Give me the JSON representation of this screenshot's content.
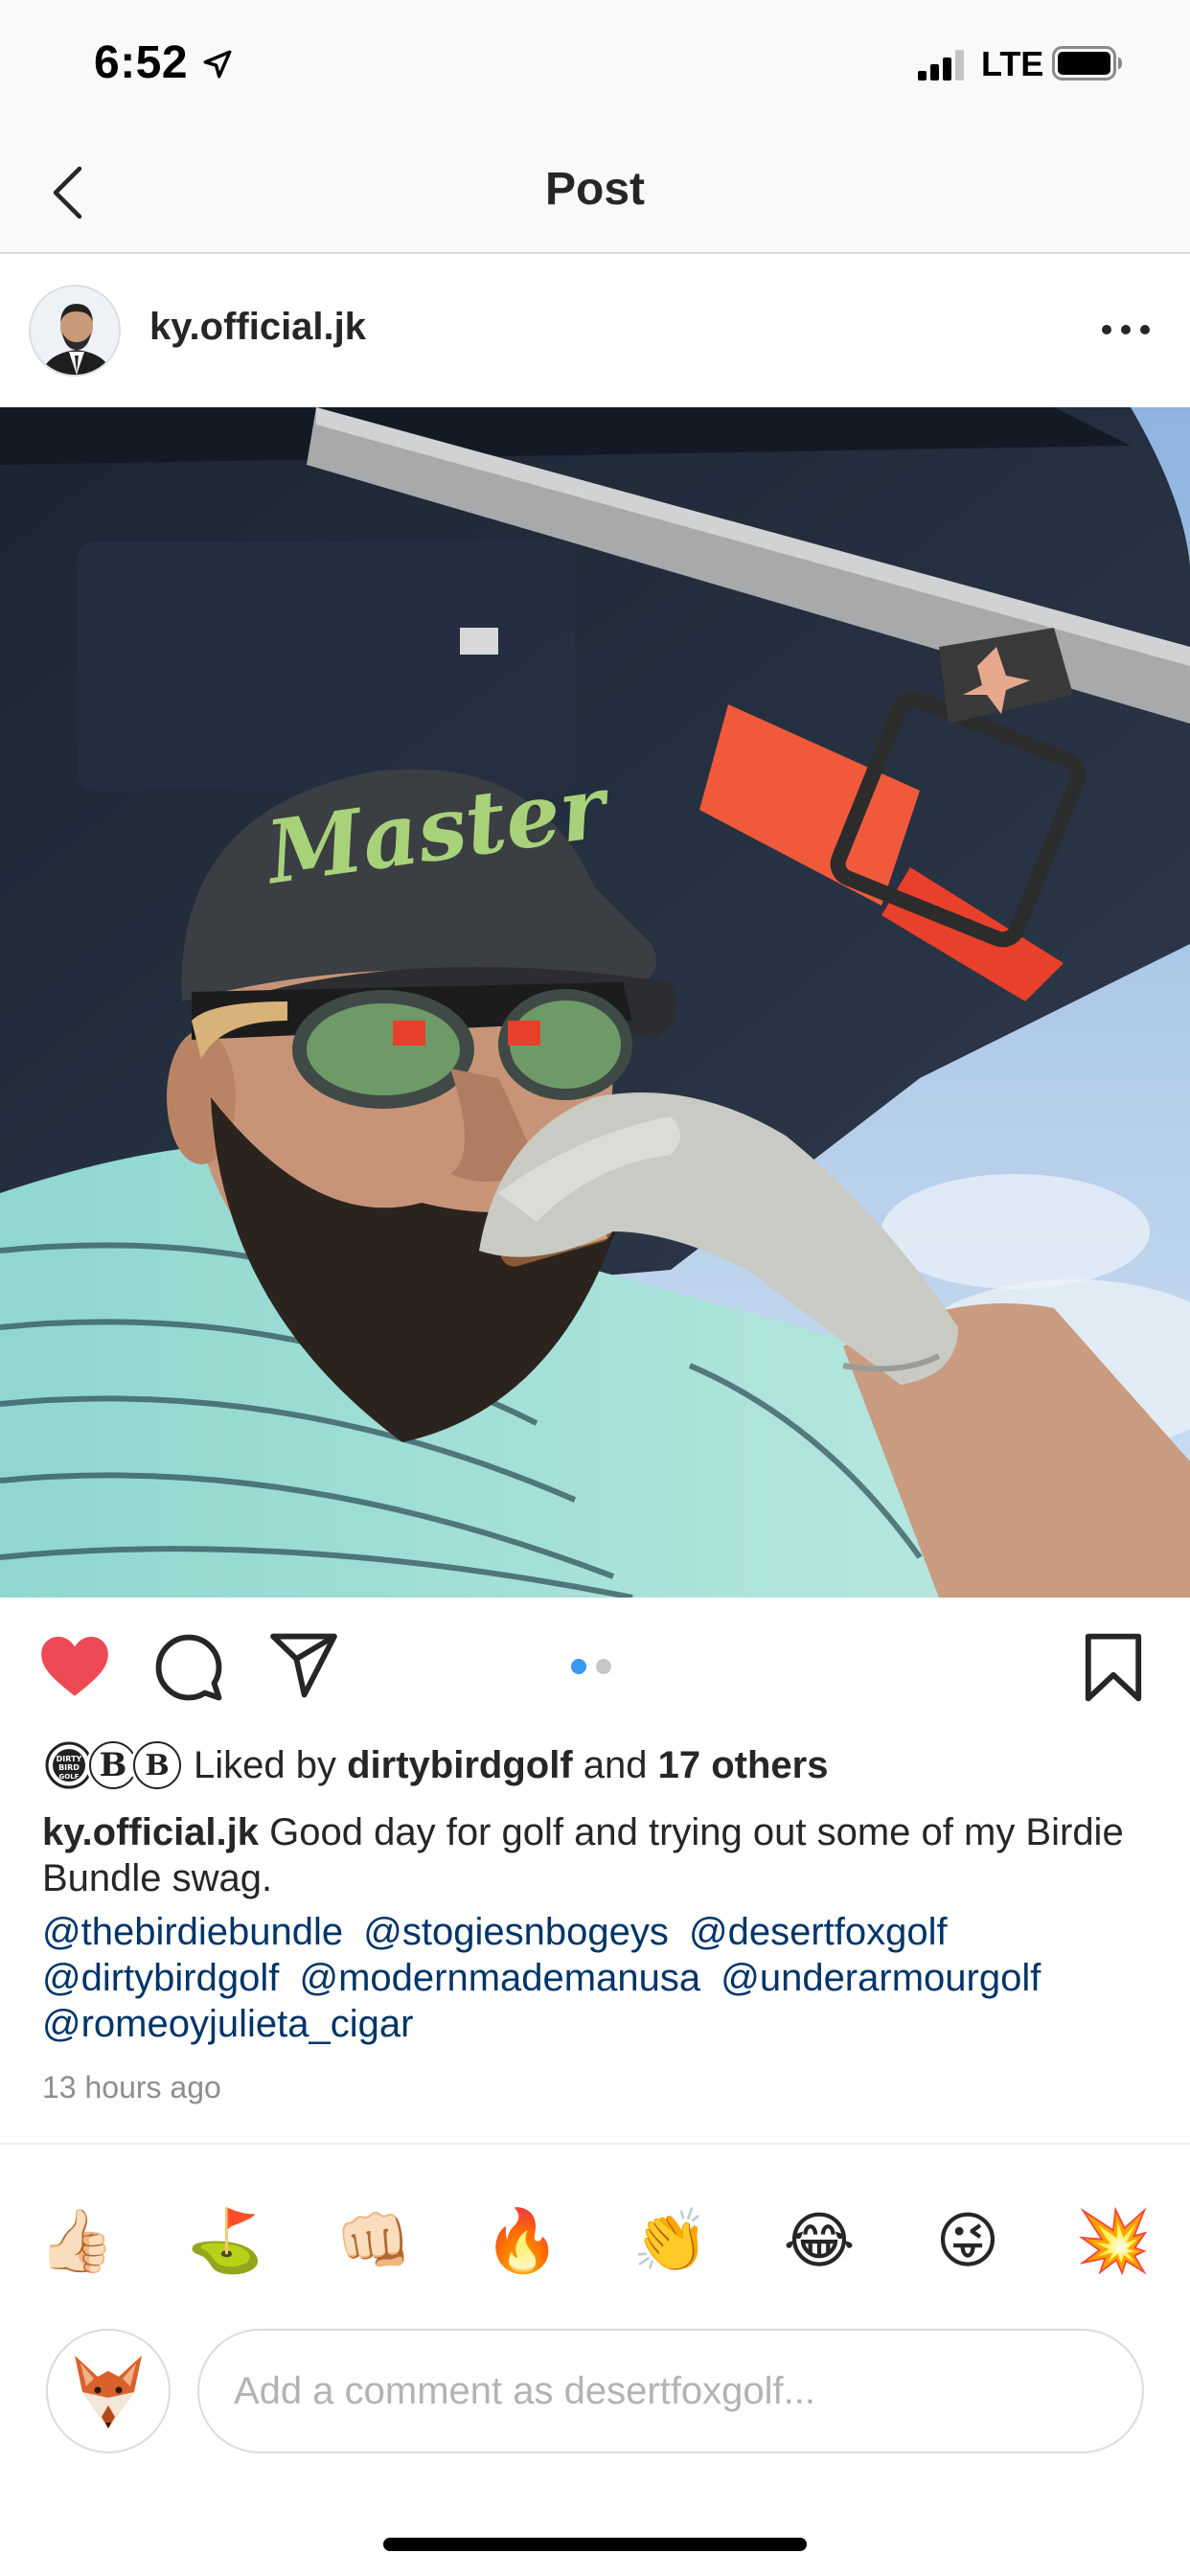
{
  "status_bar": {
    "time": "6:52",
    "network": "LTE"
  },
  "nav": {
    "title": "Post"
  },
  "post": {
    "author": "ky.official.jk",
    "image_slide_count": 2,
    "image_active_slide": 1,
    "liked": true,
    "likes": {
      "prefix": "Liked by ",
      "user": "dirtybirdgolf",
      "middle": " and ",
      "others": "17 others",
      "avatars": [
        "DIRTY BIRD GOLF",
        "B",
        "B"
      ]
    },
    "caption": {
      "user": "ky.official.jk",
      "text": " Good day for golf and trying out some of my Birdie Bundle swag."
    },
    "mentions": [
      "@thebirdiebundle",
      "@stogiesnbogeys",
      "@desertfoxgolf",
      "@dirtybirdgolf",
      "@modernmademanusa",
      "@underarmourgolf",
      "@romeoyjulieta_cigar"
    ],
    "timestamp": "13 hours ago"
  },
  "quick_reactions": [
    "👍🏻",
    "⛳",
    "👊🏻",
    "🔥",
    "👏",
    "😂",
    "😜",
    "💥"
  ],
  "comment": {
    "placeholder": "Add a comment as desertfoxgolf..."
  },
  "colors": {
    "heart": "#ed4956",
    "mention": "#003569",
    "dot_active": "#3897f0",
    "muted": "#8e8e8e"
  },
  "icons": [
    "location-arrow-icon",
    "signal-icon",
    "battery-icon",
    "back-chevron-icon",
    "more-icon",
    "heart-icon",
    "comment-icon",
    "share-icon",
    "bookmark-icon",
    "fox-icon"
  ]
}
